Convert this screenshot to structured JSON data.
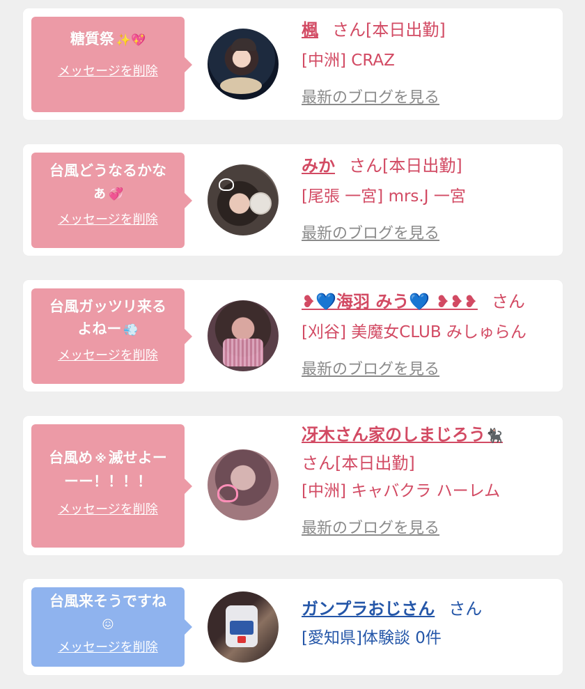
{
  "messages": [
    {
      "bubble_text": "糖質祭",
      "bubble_emoji": "✨💖",
      "delete_label": "メッセージを削除",
      "name": "楓",
      "suffix": "さん[本日出勤]",
      "shop": "[中洲] CRAZ",
      "blog_link": "最新のブログを見る"
    },
    {
      "bubble_text": "台風どうなるかな",
      "bubble_text2": "ぁ",
      "bubble_emoji": "💞",
      "delete_label": "メッセージを削除",
      "name": "みか",
      "suffix": "さん[本日出勤]",
      "shop": "[尾張 一宮] mrs.J 一宮",
      "blog_link": "最新のブログを見る"
    },
    {
      "bubble_text": "台風ガッツリ来る",
      "bubble_text2": "よねー",
      "bubble_emoji": "💨",
      "delete_label": "メッセージを削除",
      "name": "❥💙海羽 みう💙 ❥❥❥",
      "suffix": "さん",
      "shop": "[刈谷] 美魔女CLUB みしゅらん",
      "blog_link": "最新のブログを見る"
    },
    {
      "bubble_text": "台風め",
      "bubble_emoji": "※",
      "bubble_text_b": "滅せよー",
      "bubble_text2": "ーー！！！！",
      "delete_label": "メッセージを削除",
      "name": "冴木さん家のしまじろう",
      "name_emoji": "🐈‍⬛",
      "suffix": "さん[本日出勤]",
      "shop": "[中洲] キャバクラ ハーレム",
      "blog_link": "最新のブログを見る"
    },
    {
      "bubble_text": "台風来そうですね",
      "bubble_emoji": "😖",
      "delete_label": "メッセージを削除",
      "name": "ガンプラおじさん",
      "suffix": "さん",
      "shop": "[愛知県]体験談 0件"
    }
  ]
}
